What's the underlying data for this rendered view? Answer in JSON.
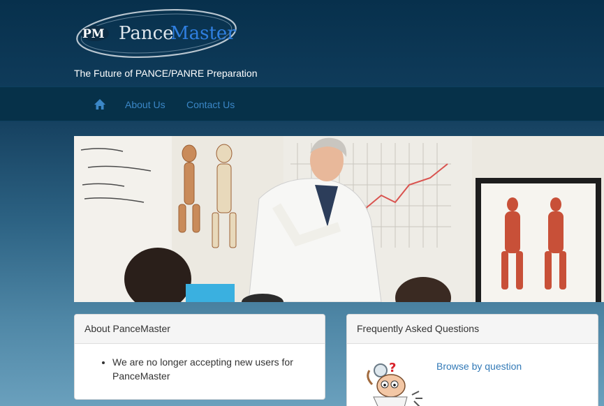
{
  "header": {
    "logo": {
      "monogram": "PM",
      "name_part1": "Pance",
      "name_part2": "Master"
    },
    "tagline": "The Future of PANCE/PANRE Preparation"
  },
  "nav": {
    "home_icon": "home-icon",
    "items": [
      {
        "label": "About Us"
      },
      {
        "label": "Contact Us"
      }
    ]
  },
  "hero": {
    "description_icon": "classroom-photo"
  },
  "about_panel": {
    "title": "About PanceMaster",
    "items": [
      "We are no longer accepting new users for PanceMaster"
    ]
  },
  "faq_panel": {
    "title": "Frequently Asked Questions",
    "link": "Browse by question",
    "image_icon": "confused-doctor-cartoon"
  },
  "colors": {
    "nav_link": "#3b87c7",
    "link": "#337ab7",
    "header_bg": "#07304c"
  }
}
